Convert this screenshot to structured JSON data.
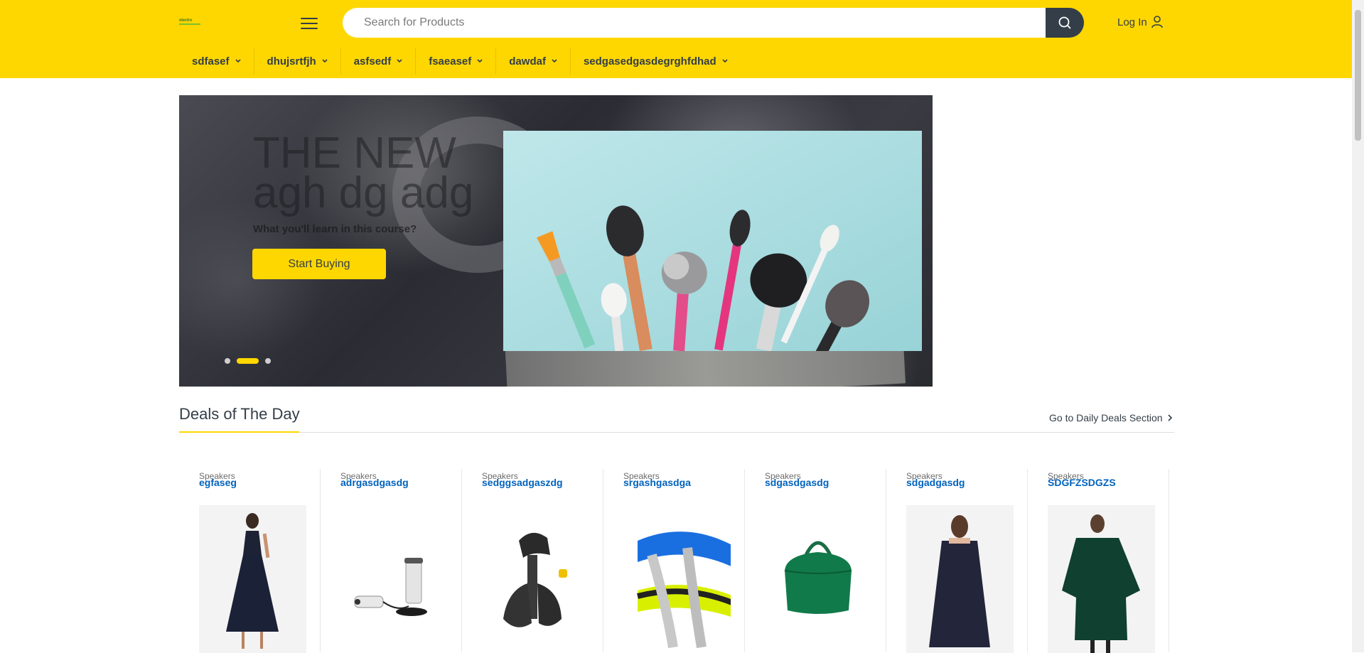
{
  "header": {
    "logo_text": "electro",
    "search": {
      "placeholder": "Search for Products",
      "value": ""
    },
    "login_label": "Log In",
    "categories": [
      {
        "label": "sdfasef"
      },
      {
        "label": "dhujsrtfjh"
      },
      {
        "label": "asfsedf"
      },
      {
        "label": "fsaeasef"
      },
      {
        "label": "dawdaf"
      },
      {
        "label": "sedgasedgasdegrghfdhad"
      }
    ]
  },
  "hero": {
    "title_line1": "THE NEW",
    "title_line2": "agh dg adg",
    "subtitle": "What you'll learn in this course?",
    "cta_label": "Start Buying",
    "slides_count": 3,
    "active_slide": 2
  },
  "deals": {
    "title": "Deals of The Day",
    "link_label": "Go to Daily Deals Section",
    "products": [
      {
        "category": "Speakers",
        "name": "egfaseg",
        "image": "navy-dress"
      },
      {
        "category": "Speakers",
        "name": "adrgasdgasdg",
        "image": "milk-frother"
      },
      {
        "category": "Speakers",
        "name": "sedggsadgaszdg",
        "image": "foot-pump"
      },
      {
        "category": "Speakers",
        "name": "srgashgasdga",
        "image": "tow-strap"
      },
      {
        "category": "Speakers",
        "name": "sdgasdgasdg",
        "image": "green-handbag"
      },
      {
        "category": "Speakers",
        "name": "sdgadgasdg",
        "image": "cape-dress"
      },
      {
        "category": "Speakers",
        "name": "SDGFZSDGZS",
        "image": "green-kaftan"
      }
    ]
  },
  "colors": {
    "brand_yellow": "#fed700",
    "text_dark": "#333e48",
    "link_blue": "#0062bd"
  }
}
